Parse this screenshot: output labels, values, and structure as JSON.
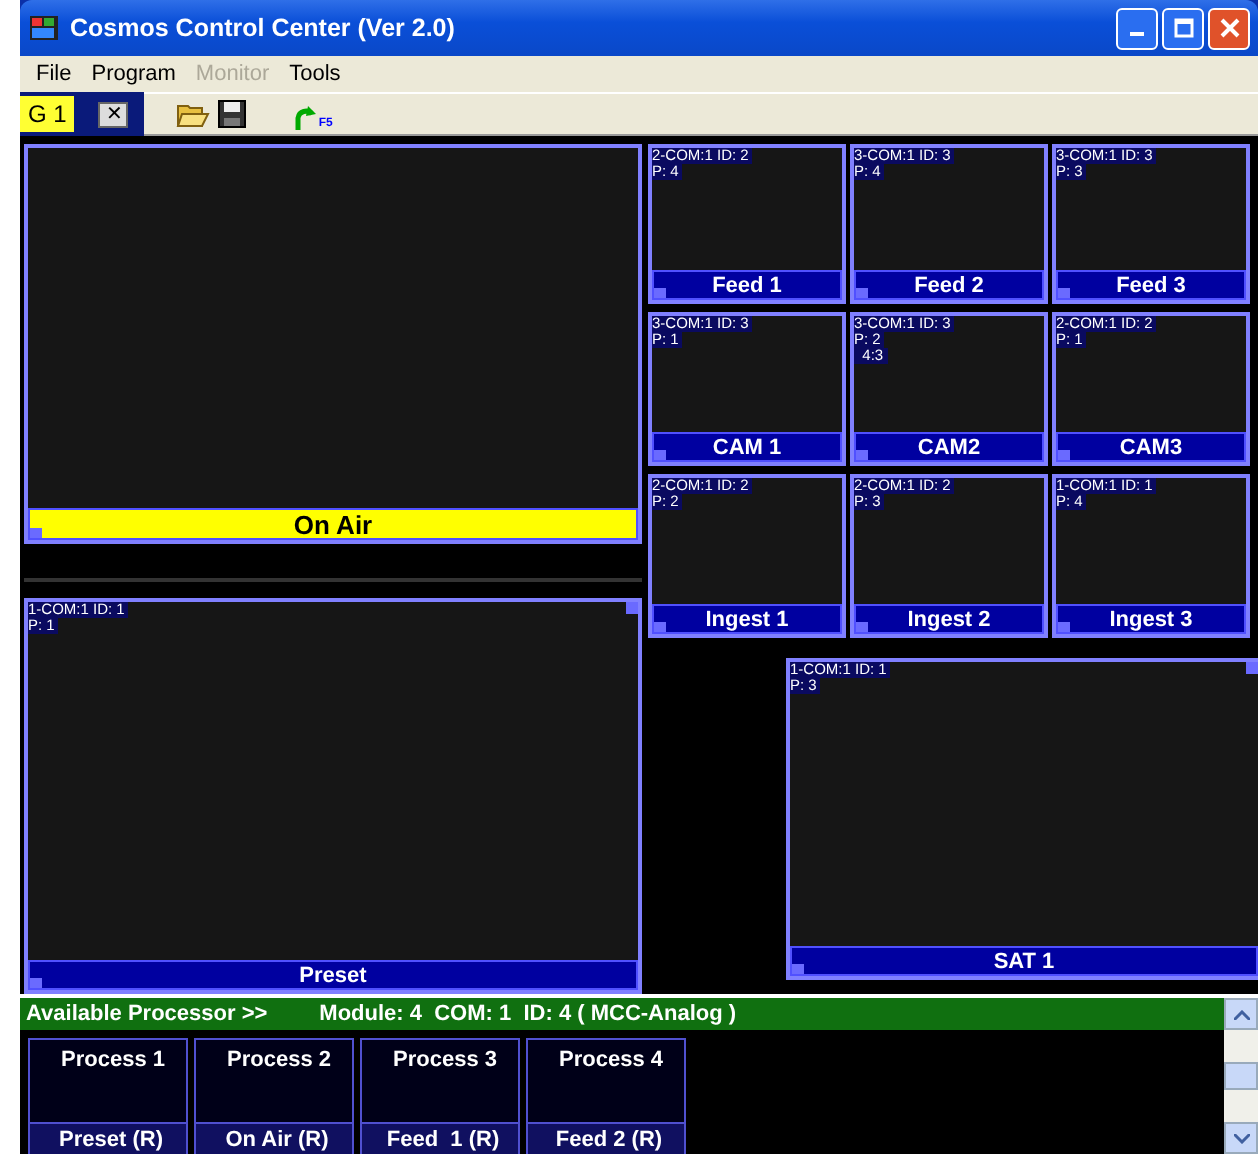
{
  "window": {
    "title": "Cosmos Control Center (Ver 2.0)"
  },
  "menu": [
    {
      "label": "File",
      "disabled": false
    },
    {
      "label": "Program",
      "disabled": false
    },
    {
      "label": "Monitor",
      "disabled": true
    },
    {
      "label": "Tools",
      "disabled": false
    }
  ],
  "toolbar": {
    "group": "G 1",
    "close_glyph": "✕",
    "refresh_key": "F5"
  },
  "main_monitors": [
    {
      "label": "On Air",
      "kind": "on_air"
    },
    {
      "label": "Preset",
      "kind": "normal",
      "info": [
        "1-COM:1 ID: 1",
        "P: 1"
      ]
    }
  ],
  "grid_monitors": [
    {
      "label": "Feed 1",
      "info": [
        "2-COM:1 ID: 2",
        "P: 4"
      ]
    },
    {
      "label": "Feed 2",
      "info": [
        "3-COM:1 ID: 3",
        "P: 4"
      ]
    },
    {
      "label": "Feed 3",
      "info": [
        "3-COM:1 ID: 3",
        "P: 3"
      ]
    },
    {
      "label": "CAM 1",
      "info": [
        "3-COM:1 ID: 3",
        "P: 1"
      ]
    },
    {
      "label": "CAM2",
      "info": [
        "3-COM:1 ID: 3",
        "P: 2",
        "  4:3"
      ]
    },
    {
      "label": "CAM3",
      "info": [
        "2-COM:1 ID: 2",
        "P: 1"
      ]
    },
    {
      "label": "Ingest 1",
      "info": [
        "2-COM:1 ID: 2",
        "P: 2"
      ]
    },
    {
      "label": "Ingest 2",
      "info": [
        "2-COM:1 ID: 2",
        "P: 3"
      ]
    },
    {
      "label": "Ingest 3",
      "info": [
        "1-COM:1 ID: 1",
        "P: 4"
      ]
    }
  ],
  "sat_monitor": {
    "label": "SAT 1",
    "info": [
      "1-COM:1 ID: 1",
      "P: 3"
    ]
  },
  "processor_bar": {
    "heading": "Available Processor >>",
    "details": "Module: 4  COM: 1  ID: 4 ( MCC-Analog )"
  },
  "processors": [
    {
      "name": "Process 1",
      "assignment": "Preset (R)"
    },
    {
      "name": "Process 2",
      "assignment": "On Air (R)"
    },
    {
      "name": "Process 3",
      "assignment": "Feed  1 (R)"
    },
    {
      "name": "Process 4",
      "assignment": "Feed 2 (R)"
    }
  ]
}
